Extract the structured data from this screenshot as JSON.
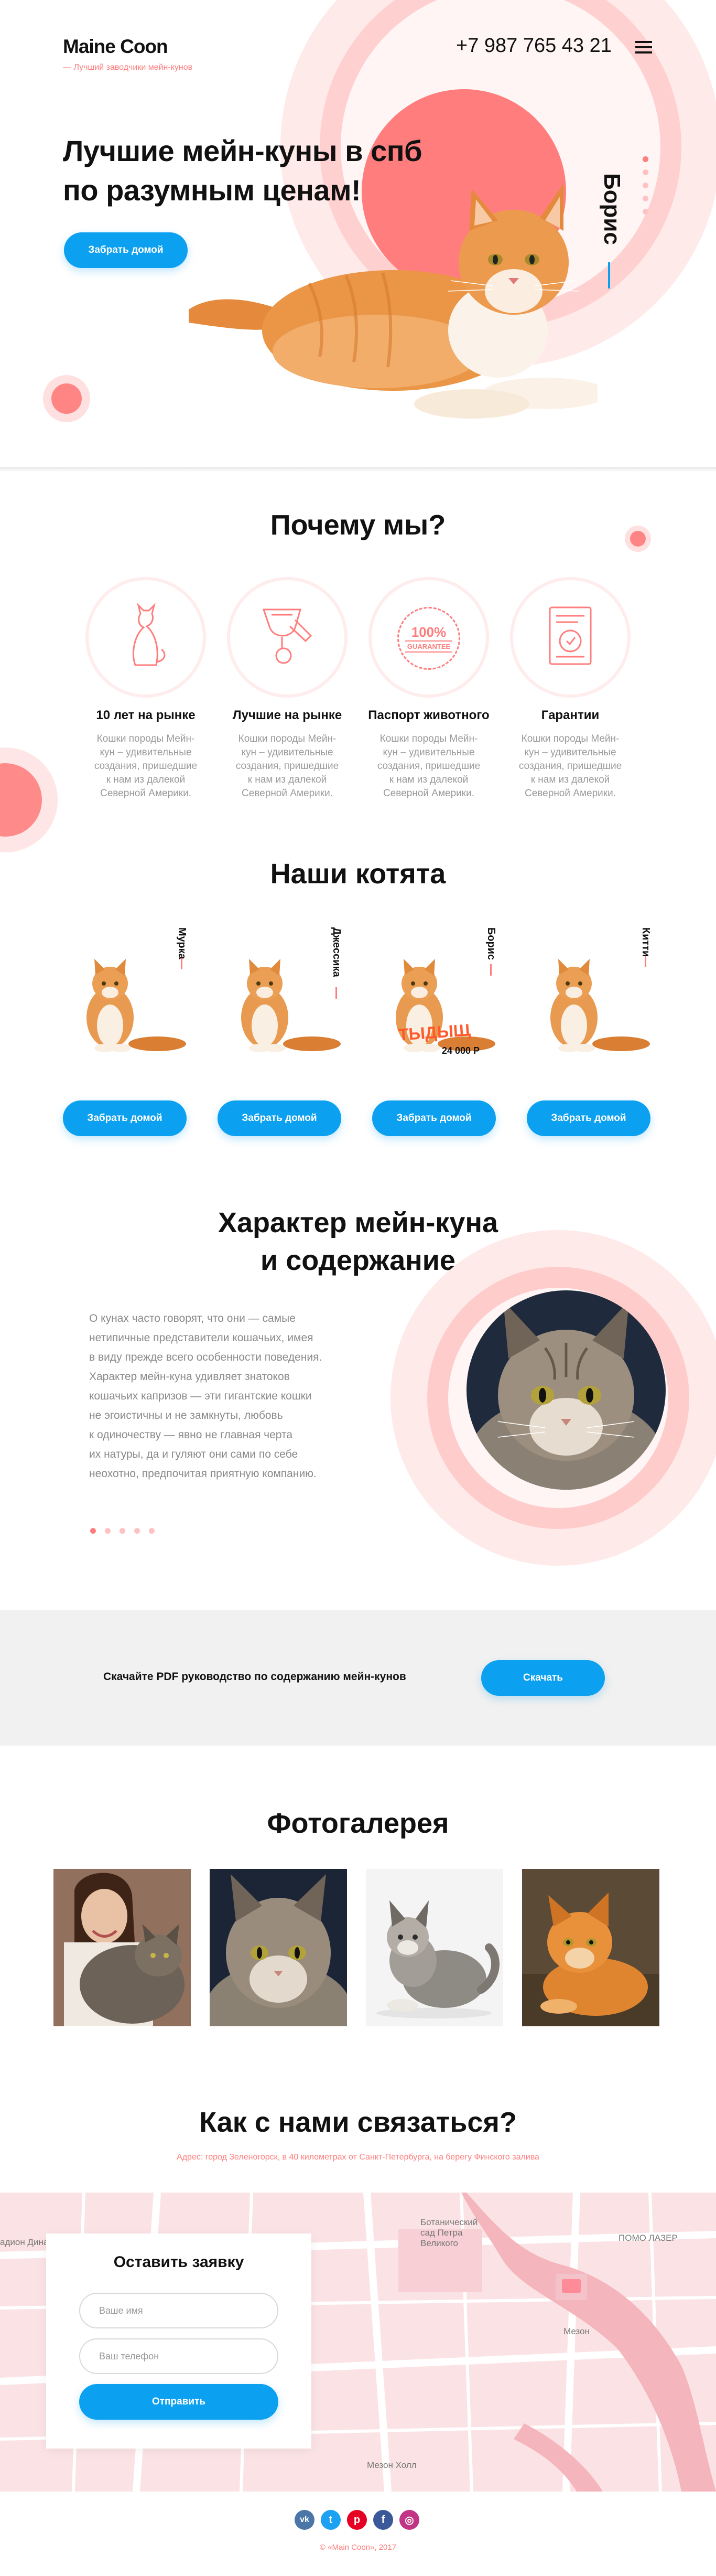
{
  "header": {
    "logo": "Maine Coon",
    "tagline": "— Лучший заводчики мейн-кунов",
    "phone": "+7 987 765 43 21",
    "menu_icon": "hamburger-icon"
  },
  "hero": {
    "headline_1": "Лучшие мейн-куны в спб",
    "headline_2": "по разумным ценам!",
    "button": "Забрать домой",
    "cat_name": "Борис",
    "slider_total": 5,
    "slider_active": 1
  },
  "why": {
    "title": "Почему мы?",
    "features": [
      {
        "icon": "cat-icon",
        "title": "10 лет на рынке",
        "text_1": "Кошки породы Мейн-",
        "text_2": "кун – удивительные",
        "text_3": "создания, пришедшие",
        "text_4": "к нам из далекой",
        "text_5": "Северной Америки."
      },
      {
        "icon": "trophy-icon",
        "title": "Лучшие на рынке",
        "text_1": "Кошки породы Мейн-",
        "text_2": "кун – удивительные",
        "text_3": "создания, пришедшие",
        "text_4": "к нам из далекой",
        "text_5": "Северной Америки."
      },
      {
        "icon": "guarantee-stamp-icon",
        "stamp_1": "100%",
        "stamp_2": "GUARANTEE",
        "title": "Паспорт животного",
        "text_1": "Кошки породы Мейн-",
        "text_2": "кун – удивительные",
        "text_3": "создания, пришедшие",
        "text_4": "к нам из далекой",
        "text_5": "Северной Америки."
      },
      {
        "icon": "certificate-icon",
        "title": "Гарантии",
        "text_1": "Кошки породы Мейн-",
        "text_2": "кун – удивительные",
        "text_3": "создания, пришедшие",
        "text_4": "к нам из далекой",
        "text_5": "Северной Америки."
      }
    ]
  },
  "kittens": {
    "title": "Наши котята",
    "items": [
      {
        "name": "Мурка",
        "button": "Забрать домой"
      },
      {
        "name": "Джессика",
        "button": "Забрать домой"
      },
      {
        "name": "Борис",
        "button": "Забрать домой",
        "badge": "ТЫДЫЩ",
        "price": "24 000 Р"
      },
      {
        "name": "Китти",
        "button": "Забрать домой"
      }
    ]
  },
  "character": {
    "title_1": "Характер мейн-куна",
    "title_2": "и содержание",
    "lines": [
      "О кунах часто говорят, что они — самые",
      "нетипичные представители кошачьих, имея",
      "в виду прежде всего особенности поведения.",
      "Характер мейн-куна удивляет знатоков",
      "кошачьих капризов — эти гигантские кошки",
      "не эгоистичны и не замкнуты, любовь",
      "к одиночеству — явно не главная черта",
      "их натуры, да и гуляют они сами по себе",
      "неохотно, предпочитая приятную компанию."
    ],
    "dots_total": 5,
    "dots_active": 1
  },
  "pdf": {
    "text": "Скачайте PDF руководство по содержанию мейн-кунов",
    "button": "Скачать"
  },
  "gallery": {
    "title": "Фотогалерея"
  },
  "contact": {
    "title": "Как с нами связаться?",
    "address": "Адрес: город Зеленогорск, в 40 километрах от Санкт-Петербурга, на берегу Финского залива",
    "form_title": "Оставить заявку",
    "name_placeholder": "Ваше имя",
    "phone_placeholder": "Ваш телефон",
    "submit": "Отправить",
    "map_labels": {
      "garden_1": "Ботанический",
      "garden_2": "сад Петра",
      "garden_3": "Великого",
      "lazer": "ПОМО ЛАЗЕР",
      "mezon": "Мезон",
      "mezon_hall": "Мезон Холл",
      "dino": "адион Дина"
    }
  },
  "footer": {
    "copyright": "© «Main Coon», 2017",
    "socials": [
      {
        "icon": "vk-icon",
        "glyph": "vk",
        "color": "#4a76a8"
      },
      {
        "icon": "twitter-icon",
        "glyph": "t",
        "color": "#1da1f2"
      },
      {
        "icon": "pinterest-icon",
        "glyph": "p",
        "color": "#e60023"
      },
      {
        "icon": "facebook-icon",
        "glyph": "f",
        "color": "#3b5998"
      },
      {
        "icon": "instagram-icon",
        "glyph": "◎",
        "color": "#c13584"
      }
    ]
  },
  "colors": {
    "accent": "#ff7d7d",
    "pink_light": "#ffe6e6",
    "pink_mid": "#ffcccc",
    "button_blue": "#0ca0f0"
  }
}
